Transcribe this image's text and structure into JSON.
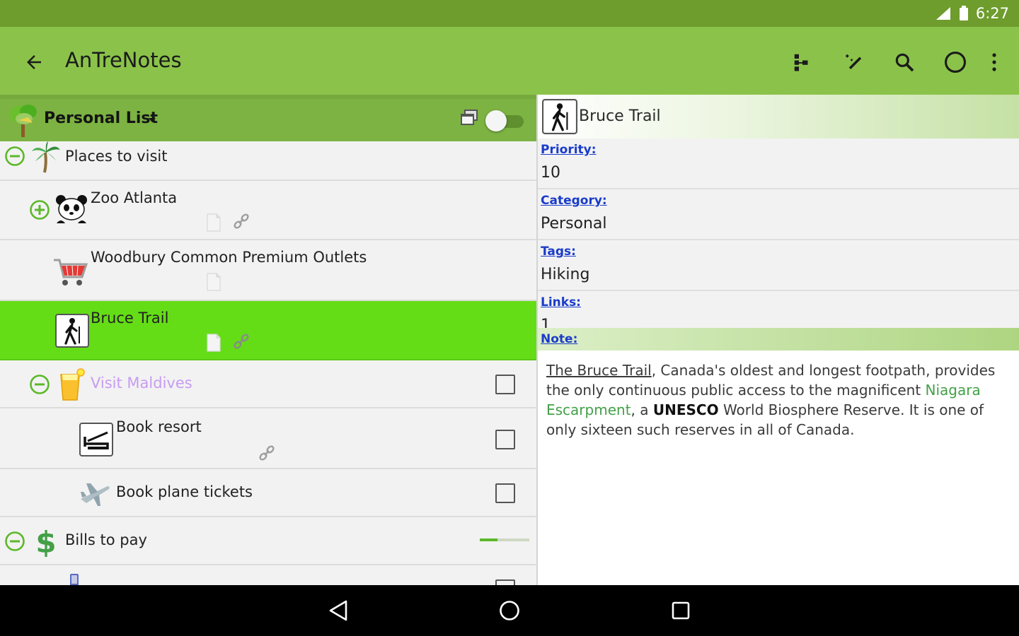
{
  "status": {
    "time": "6:27"
  },
  "appbar": {
    "title": "AnTreNotes"
  },
  "list": {
    "name": "Personal List",
    "toggle_on": false
  },
  "rows": [
    {
      "label": "Places to visit"
    },
    {
      "label": "Zoo Atlanta"
    },
    {
      "label": "Woodbury Common Premium Outlets"
    },
    {
      "label": "Bruce Trail"
    },
    {
      "label": "Visit Maldives"
    },
    {
      "label": "Book resort"
    },
    {
      "label": "Book plane tickets"
    },
    {
      "label": "Bills to pay",
      "progress": 0.35
    }
  ],
  "detail": {
    "title": "Bruce Trail",
    "fields": [
      {
        "label": "Priority:",
        "value": "10"
      },
      {
        "label": "Category:",
        "value": "Personal"
      },
      {
        "label": "Tags:",
        "value": "Hiking"
      },
      {
        "label": "Links:",
        "value": "1"
      }
    ],
    "note_label": "Note:",
    "note": {
      "link1": "The Bruce Trail",
      "part1": ", Canada's oldest and longest footpath, provides the only continuous public access to the magnificent ",
      "green": "Niagara Escarpment",
      "part2": ", a ",
      "bold": "UNESCO",
      "part3": " World Biosphere Reserve. It is one of only sixteen such reserves in all of Canada."
    }
  },
  "colors": {
    "statusbar": "#6e9c2d",
    "appbar": "#8bc34a",
    "selected_row": "#64dd17",
    "link_blue": "#1a3cc9"
  }
}
